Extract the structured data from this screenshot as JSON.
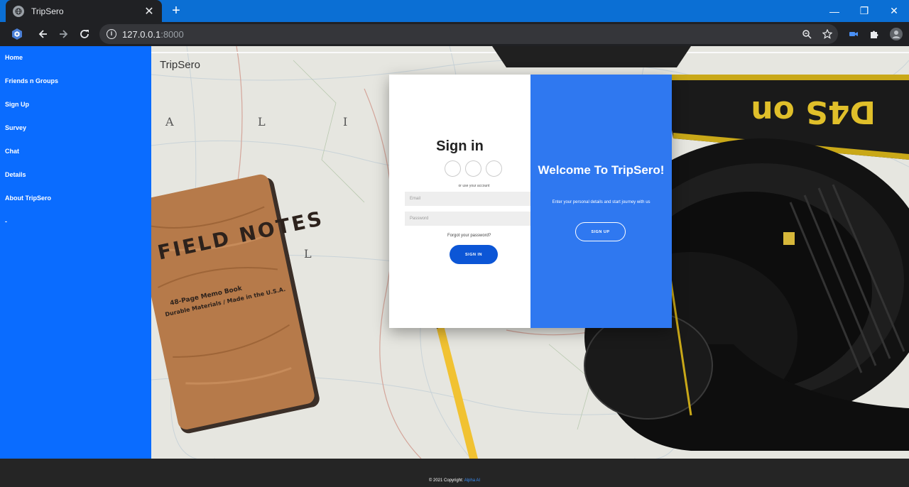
{
  "browser": {
    "tab_title": "TripSero",
    "close_tab": "✕",
    "new_tab": "+",
    "url_host": "127.0.0.1",
    "url_port": ":8000",
    "minimize": "—",
    "maximize": "❐",
    "close_window": "✕"
  },
  "sidebar": {
    "items": [
      {
        "label": "Home"
      },
      {
        "label": "Friends n Groups"
      },
      {
        "label": "Sign Up"
      },
      {
        "label": "Survey"
      },
      {
        "label": "Chat"
      },
      {
        "label": "Details"
      },
      {
        "label": "About TripSero"
      },
      {
        "label": "-"
      }
    ]
  },
  "brand": "TripSero",
  "signin": {
    "title": "Sign in",
    "use_account": "or use your account",
    "email_placeholder": "Email",
    "password_placeholder": "Password",
    "forgot": "Forgot your password?",
    "button": "SIGN IN"
  },
  "welcome": {
    "title": "Welcome To TripSero!",
    "subtitle": "Enter your personal details and start journey with us",
    "button": "SIGN UP"
  },
  "background": {
    "notebook_title": "FIELD NOTES",
    "notebook_sub1": "48-Page Memo Book",
    "notebook_sub2": "Durable Materials / Made in the U.S.A.",
    "strap_text": "D4S  on",
    "map_letters": [
      "A",
      "L",
      "I",
      "L"
    ]
  },
  "footer": {
    "copyright": "© 2021 Copyright: ",
    "link": "Alpha AI"
  },
  "colors": {
    "sidebar": "#0a6cff",
    "welcome_panel": "#2f78f0",
    "signin_button": "#0c56d6",
    "tabbar": "#0b6fd4"
  }
}
